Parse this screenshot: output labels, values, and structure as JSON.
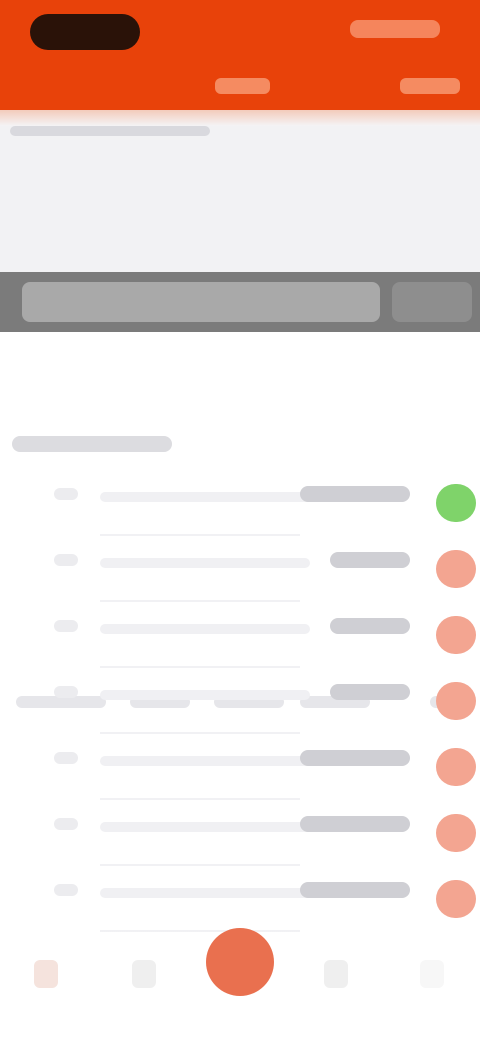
{
  "header": {
    "brand": "",
    "right_label": "",
    "tabs": [
      "",
      ""
    ]
  },
  "info": {
    "text": ""
  },
  "search": {
    "placeholder": "",
    "button_label": ""
  },
  "filters": [
    "",
    "",
    "",
    "",
    ""
  ],
  "section": {
    "title": ""
  },
  "list": {
    "rows": [
      {
        "index": "",
        "name": "",
        "value": "",
        "status": "positive"
      },
      {
        "index": "",
        "name": "",
        "value": "",
        "status": "negative"
      },
      {
        "index": "",
        "name": "",
        "value": "",
        "status": "negative"
      },
      {
        "index": "",
        "name": "",
        "value": "",
        "status": "negative"
      },
      {
        "index": "",
        "name": "",
        "value": "",
        "status": "negative"
      },
      {
        "index": "",
        "name": "",
        "value": "",
        "status": "negative"
      },
      {
        "index": "",
        "name": "",
        "value": "",
        "status": "negative"
      }
    ]
  },
  "bottom_nav": [
    "home-icon",
    "list-icon",
    "center-action-icon",
    "chart-icon",
    "profile-icon"
  ],
  "colors": {
    "brand": "#e8420a",
    "positive": "#7fd36a",
    "negative": "#f3a591",
    "action": "#e9704f"
  }
}
